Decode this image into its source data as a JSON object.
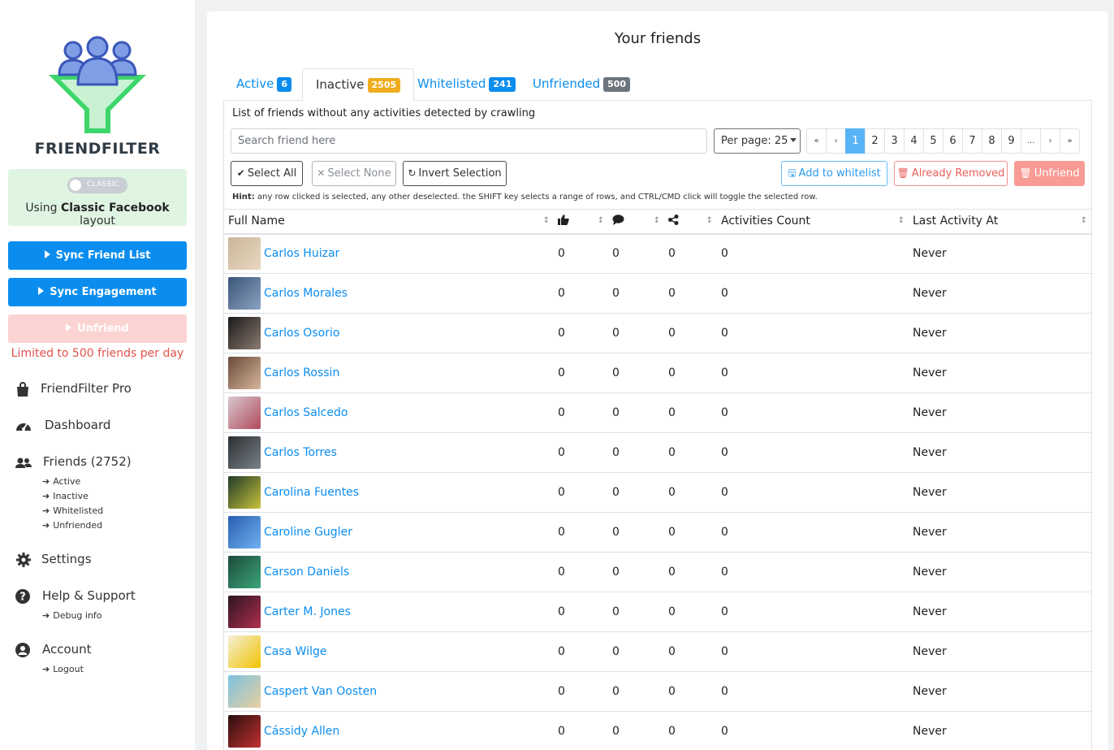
{
  "sidebar": {
    "brand": "FRIENDFILTER",
    "layout_toggle": "CLASSIC",
    "layout_prefix": "Using ",
    "layout_name": "Classic Facebook",
    "layout_suffix": " layout",
    "sync_friend_list": "Sync Friend List",
    "sync_engagement": "Sync Engagement",
    "unfriend": "Unfriend",
    "limit_text": "Limited to 500 friends per day",
    "nav": {
      "pro": "FriendFilter Pro",
      "dashboard": "Dashboard",
      "friends": "Friends (2752)",
      "friends_sub": [
        "Active",
        "Inactive",
        "Whitelisted",
        "Unfriended"
      ],
      "settings": "Settings",
      "help": "Help & Support",
      "help_sub": "Debug info",
      "account": "Account",
      "account_sub": "Logout"
    }
  },
  "main": {
    "title": "Your friends",
    "tabs": [
      {
        "label": "Active",
        "count": "6",
        "color": "#0b8def"
      },
      {
        "label": "Inactive",
        "count": "2505",
        "color": "#f0ad1e"
      },
      {
        "label": "Whitelisted",
        "count": "241",
        "color": "#0b8def"
      },
      {
        "label": "Unfriended",
        "count": "500",
        "color": "#6c757d"
      }
    ],
    "description": "List of friends without any activities detected by crawling",
    "search_placeholder": "Search friend here",
    "per_page": "Per page: 25",
    "pagination": [
      "«",
      "‹",
      "1",
      "2",
      "3",
      "4",
      "5",
      "6",
      "7",
      "8",
      "9",
      "...",
      "›",
      "»"
    ],
    "buttons": {
      "select_all": "Select All",
      "select_none": "Select None",
      "invert": "Invert Selection",
      "whitelist": "Add to whitelist",
      "already_removed": "Already Removed",
      "unfriend": "Unfriend"
    },
    "hint_label": "Hint:",
    "hint_text": " any row clicked is selected, any other deselected. the SHIFT key selects a range of rows, and CTRL/CMD click will toggle the selected row.",
    "columns": {
      "full_name": "Full Name",
      "likes": "like-icon",
      "comments": "comment-icon",
      "shares": "share-icon",
      "activities": "Activities Count",
      "last_activity": "Last Activity At"
    },
    "rows": [
      {
        "name": "Carlos Huizar",
        "likes": "0",
        "comments": "0",
        "shares": "0",
        "activities": "0",
        "last": "Never",
        "avatar": [
          "#c9b59a",
          "#e8d7bf"
        ]
      },
      {
        "name": "Carlos Morales",
        "likes": "0",
        "comments": "0",
        "shares": "0",
        "activities": "0",
        "last": "Never",
        "avatar": [
          "#3b5577",
          "#8aa3c2"
        ]
      },
      {
        "name": "Carlos Osorio",
        "likes": "0",
        "comments": "0",
        "shares": "0",
        "activities": "0",
        "last": "Never",
        "avatar": [
          "#1a1a1a",
          "#8c7b70"
        ]
      },
      {
        "name": "Carlos Rossin",
        "likes": "0",
        "comments": "0",
        "shares": "0",
        "activities": "0",
        "last": "Never",
        "avatar": [
          "#6b4a3a",
          "#d6b69a"
        ]
      },
      {
        "name": "Carlos Salcedo",
        "likes": "0",
        "comments": "0",
        "shares": "0",
        "activities": "0",
        "last": "Never",
        "avatar": [
          "#d8c8d0",
          "#b04a5a"
        ]
      },
      {
        "name": "Carlos Torres",
        "likes": "0",
        "comments": "0",
        "shares": "0",
        "activities": "0",
        "last": "Never",
        "avatar": [
          "#2b2f33",
          "#7a8288"
        ]
      },
      {
        "name": "Carolina Fuentes",
        "likes": "0",
        "comments": "0",
        "shares": "0",
        "activities": "0",
        "last": "Never",
        "avatar": [
          "#1f3a2a",
          "#c9c23a"
        ]
      },
      {
        "name": "Caroline Gugler",
        "likes": "0",
        "comments": "0",
        "shares": "0",
        "activities": "0",
        "last": "Never",
        "avatar": [
          "#2a5fb0",
          "#6fb0f0"
        ]
      },
      {
        "name": "Carson Daniels",
        "likes": "0",
        "comments": "0",
        "shares": "0",
        "activities": "0",
        "last": "Never",
        "avatar": [
          "#1e4a3a",
          "#3aa57a"
        ]
      },
      {
        "name": "Carter M. Jones",
        "likes": "0",
        "comments": "0",
        "shares": "0",
        "activities": "0",
        "last": "Never",
        "avatar": [
          "#2a1420",
          "#b03050"
        ]
      },
      {
        "name": "Casa Wilge",
        "likes": "0",
        "comments": "0",
        "shares": "0",
        "activities": "0",
        "last": "Never",
        "avatar": [
          "#f4f0d8",
          "#f2c200"
        ]
      },
      {
        "name": "Caspert Van Oosten",
        "likes": "0",
        "comments": "0",
        "shares": "0",
        "activities": "0",
        "last": "Never",
        "avatar": [
          "#7cc2e0",
          "#e8cfa0"
        ]
      },
      {
        "name": "Cássidy Allen",
        "likes": "0",
        "comments": "0",
        "shares": "0",
        "activities": "0",
        "last": "Never",
        "avatar": [
          "#2a0f10",
          "#c23030"
        ]
      }
    ]
  }
}
